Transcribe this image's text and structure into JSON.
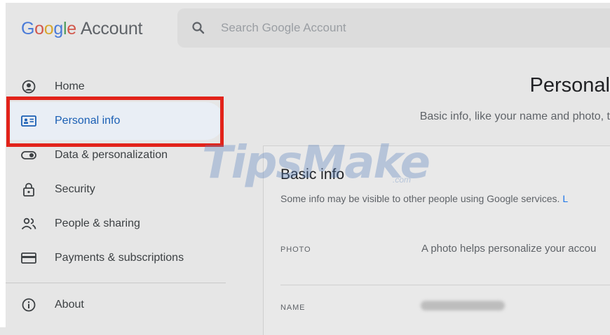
{
  "header": {
    "logo_parts": [
      "G",
      "o",
      "o",
      "g",
      "l",
      "e"
    ],
    "logo_suffix": "Account",
    "search_placeholder": "Search Google Account"
  },
  "sidebar": {
    "items": [
      {
        "label": "Home",
        "icon": "account-circle-icon"
      },
      {
        "label": "Personal info",
        "icon": "id-card-icon",
        "active": true
      },
      {
        "label": "Data & personalization",
        "icon": "toggle-icon"
      },
      {
        "label": "Security",
        "icon": "lock-icon"
      },
      {
        "label": "People & sharing",
        "icon": "people-icon"
      },
      {
        "label": "Payments & subscriptions",
        "icon": "credit-card-icon"
      },
      {
        "label": "About",
        "icon": "info-icon"
      }
    ]
  },
  "main": {
    "title": "Personal",
    "subtitle": "Basic info, like your name and photo, t",
    "card": {
      "title": "Basic info",
      "subtitle": "Some info may be visible to other people using Google services.",
      "subtitle_link": "L",
      "rows": [
        {
          "label": "PHOTO",
          "value": "A photo helps personalize your accou"
        },
        {
          "label": "NAME",
          "value": ""
        }
      ]
    }
  },
  "watermark": {
    "text": "TipsMake",
    "small": ".com"
  },
  "colors": {
    "highlight": "#e2231a",
    "active_text": "#1a5fb4",
    "link": "#1a73e8"
  }
}
